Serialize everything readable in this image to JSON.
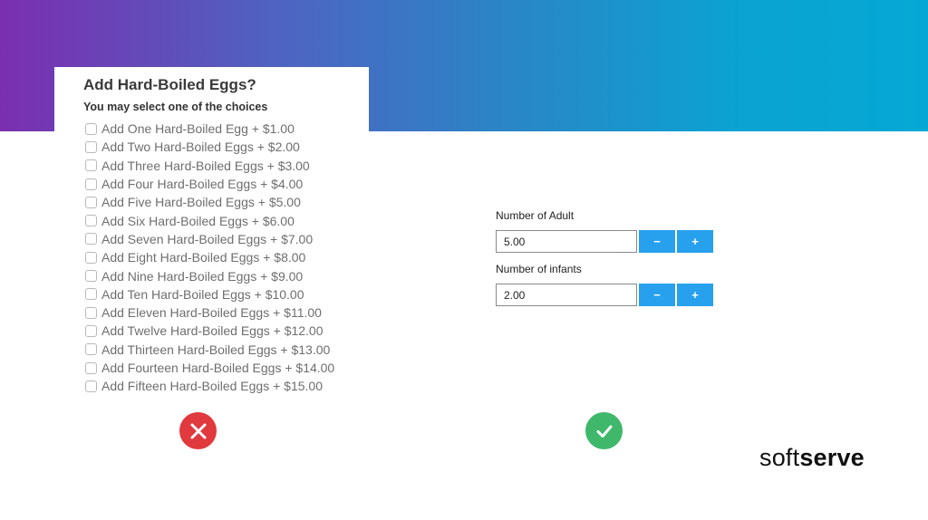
{
  "colors": {
    "banner_start": "#7a2fb0",
    "banner_end": "#05a8d4",
    "stepper_blue": "#27a0ee",
    "bad": "#e0393e",
    "good": "#3fb86b"
  },
  "bad_example": {
    "title": "Add Hard-Boiled Eggs?",
    "subtitle": "You may select one of the choices",
    "options": [
      "Add One Hard-Boiled Egg + $1.00",
      "Add Two Hard-Boiled Eggs + $2.00",
      "Add Three Hard-Boiled Eggs + $3.00",
      "Add Four Hard-Boiled Eggs + $4.00",
      "Add Five Hard-Boiled Eggs + $5.00",
      "Add Six Hard-Boiled Eggs + $6.00",
      "Add Seven Hard-Boiled Eggs + $7.00",
      "Add Eight Hard-Boiled Eggs + $8.00",
      "Add Nine Hard-Boiled Eggs + $9.00",
      "Add Ten Hard-Boiled Eggs + $10.00",
      "Add Eleven Hard-Boiled Eggs + $11.00",
      "Add Twelve Hard-Boiled Eggs + $12.00",
      "Add Thirteen Hard-Boiled Eggs + $13.00",
      "Add Fourteen Hard-Boiled Eggs + $14.00",
      "Add Fifteen Hard-Boiled Eggs + $15.00"
    ],
    "icon": "x-mark-icon"
  },
  "good_example": {
    "adult": {
      "label": "Number of Adult",
      "value": "5.00",
      "minus": "−",
      "plus": "+"
    },
    "infants": {
      "label": "Number of infants",
      "value": "2.00",
      "minus": "−",
      "plus": "+"
    },
    "icon": "checkmark-icon"
  },
  "brand": {
    "part1": "soft",
    "part2": "serve"
  }
}
